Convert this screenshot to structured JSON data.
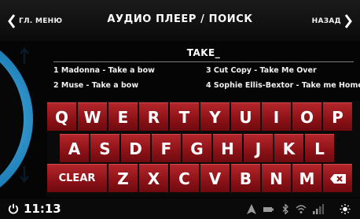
{
  "header": {
    "back_menu_label": "ГЛ. МЕНЮ",
    "title": "АУДИО ПЛЕЕР / ПОИСК",
    "back_label": "НАЗАД"
  },
  "search": {
    "value": "TAKE_"
  },
  "results": [
    "1 Madonna - Take a bow",
    "2 Muse - Take a bow",
    "3 Cut Copy - Take Me Over",
    "4 Sophie Ellis-Bextor - Take me Home"
  ],
  "keyboard": {
    "row1": [
      "Q",
      "W",
      "E",
      "R",
      "T",
      "Y",
      "U",
      "I",
      "O",
      "P"
    ],
    "row2": [
      "A",
      "S",
      "D",
      "F",
      "G",
      "H",
      "J",
      "K",
      "L"
    ],
    "row3": [
      "Z",
      "X",
      "C",
      "V",
      "B",
      "N",
      "M"
    ],
    "clear_label": "CLEAR"
  },
  "status": {
    "time": "11:13"
  },
  "colors": {
    "key_red": "#9e1a1f",
    "dial_blue": "#1f7fb8",
    "background": "#050505"
  },
  "icons": {
    "header_left": "chevron-left-icon",
    "header_right": "chevron-right-icon",
    "dial_up": "arrow-up-icon",
    "dial_down": "arrow-down-icon",
    "backspace": "backspace-icon",
    "power": "power-icon",
    "status": [
      "navigation-icon",
      "battery-icon",
      "bluetooth-icon",
      "wifi-icon",
      "signal-icon",
      "brightness-icon"
    ]
  }
}
